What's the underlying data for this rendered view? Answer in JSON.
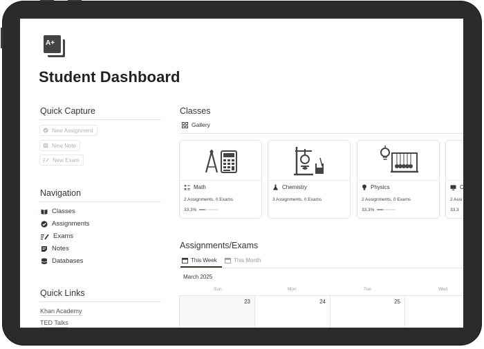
{
  "page": {
    "title": "Student Dashboard"
  },
  "quick_capture": {
    "heading": "Quick Capture",
    "buttons": [
      {
        "label": "New Assignment",
        "icon": "check-circle-icon"
      },
      {
        "label": "New Note",
        "icon": "note-icon"
      },
      {
        "label": "New Exam",
        "icon": "exam-icon"
      }
    ]
  },
  "navigation": {
    "heading": "Navigation",
    "items": [
      {
        "label": "Classes",
        "icon": "book-icon"
      },
      {
        "label": "Assignments",
        "icon": "check-circle-icon"
      },
      {
        "label": "Exams",
        "icon": "exam-icon"
      },
      {
        "label": "Notes",
        "icon": "note-icon"
      },
      {
        "label": "Databases",
        "icon": "database-icon"
      }
    ]
  },
  "quick_links": {
    "heading": "Quick Links",
    "links": [
      "Khan Academy",
      "TED Talks"
    ]
  },
  "classes": {
    "heading": "Classes",
    "view_tab": "Gallery",
    "cards": [
      {
        "name": "Math",
        "counts": "2 Assignments, 0 Exams",
        "progress": "33.3%",
        "progress_value": 0.333,
        "icon": "math-icon"
      },
      {
        "name": "Chemistry",
        "counts": "3 Assignments, 0 Exams",
        "progress": "",
        "icon": "flask-icon"
      },
      {
        "name": "Physics",
        "counts": "2 Assignments, 0 Exams",
        "progress": "33.3%",
        "progress_value": 0.333,
        "icon": "bulb-icon"
      },
      {
        "name": "C",
        "counts": "2 Assi",
        "progress": "33.3",
        "progress_value": 0.333,
        "icon": "monitor-icon"
      }
    ]
  },
  "assignments_exams": {
    "heading": "Assignments/Exams",
    "tabs": [
      "This Week",
      "This Month"
    ],
    "active_tab": "This Week",
    "month_label": "March 2025",
    "weekdays": [
      "Sun",
      "Mon",
      "Tue",
      "Wed"
    ],
    "dates": [
      "23",
      "24",
      "25",
      ""
    ]
  },
  "colors": {
    "text": "#37352f",
    "muted": "#9b9a97",
    "device": "#2b2b2b",
    "today_cell": "#f7f7f5"
  }
}
